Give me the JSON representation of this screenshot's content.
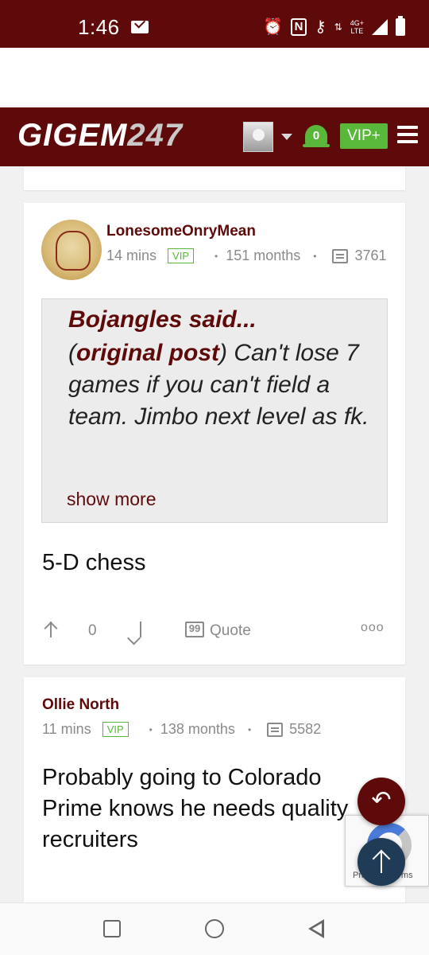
{
  "status_bar": {
    "time": "1:46",
    "network_top": "4G+",
    "network_bottom": "LTE",
    "icons": [
      "mail-icon",
      "alarm-icon",
      "nfc-icon",
      "vpn-key-icon",
      "data-arrows-icon",
      "signal-icon",
      "battery-icon"
    ]
  },
  "header": {
    "logo_text": "GIGEM",
    "logo_num": "247",
    "notifications_count": "0",
    "vip_label": "VIP+",
    "colors": {
      "brand": "#5e0a0a",
      "accent": "#59b73a"
    }
  },
  "posts": [
    {
      "username": "LonesomeOnryMean",
      "time": "14 mins",
      "badge": "VIP",
      "tenure": "151 months",
      "post_count": "3761",
      "quote": {
        "author": "Bojangles said...",
        "original_label": "original post",
        "text": " Can't lose 7 games if you can't field a team. Jimbo next level as fk.",
        "show_more": "show more"
      },
      "body": "5-D chess",
      "vote_count": "0",
      "quote_label": "Quote",
      "more": "ooo"
    },
    {
      "username": "Ollie North",
      "time": "11 mins",
      "badge": "VIP",
      "tenure": "138 months",
      "post_count": "5582",
      "body": "Probably going to Colorado Prime knows he needs quality recruiters"
    }
  ],
  "recaptcha": {
    "text": "Privacy - Terms"
  }
}
